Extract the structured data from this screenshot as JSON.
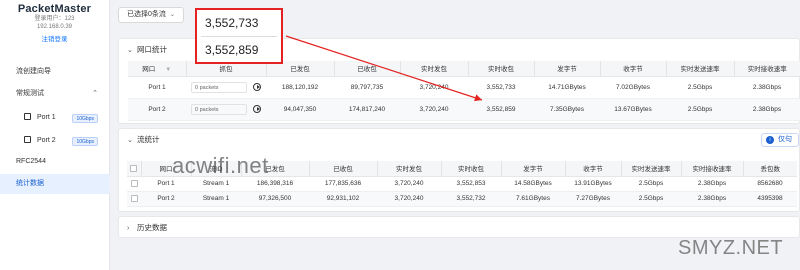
{
  "sidebar": {
    "app_name": "PacketMaster",
    "user_label": "登录用户：123",
    "ip": "192.168.0.39",
    "logout": "注销登录",
    "items": [
      {
        "label": "流创建向导"
      },
      {
        "label": "常规测试"
      },
      {
        "label": "Port 1",
        "badge": "10Gbps"
      },
      {
        "label": "Port 2",
        "badge": "10Gbps"
      },
      {
        "label": "RFC2544"
      },
      {
        "label": "统计数据"
      }
    ]
  },
  "header": {
    "selector_label": "已选择0条流"
  },
  "callout": {
    "values": [
      "3,552,733",
      "3,552,859"
    ]
  },
  "port_stats": {
    "title": "网口统计",
    "columns": [
      "网口",
      "抓包",
      "已发包",
      "已收包",
      "实时发包",
      "实时收包",
      "发字节",
      "收字节",
      "实时发送速率",
      "实时接收速率"
    ],
    "rows": [
      {
        "port": "Port 1",
        "capture": "0 packets",
        "sent": "188,120,192",
        "recv": "89,797,735",
        "rt_sent": "3,720,240",
        "rt_recv": "3,552,733",
        "tx_bytes": "14.71GBytes",
        "rx_bytes": "7.02GBytes",
        "tx_rate": "2.5Gbps",
        "rx_rate": "2.38Gbps"
      },
      {
        "port": "Port 2",
        "capture": "0 packets",
        "sent": "94,047,350",
        "recv": "174,817,240",
        "rt_sent": "3,720,240",
        "rt_recv": "3,552,859",
        "tx_bytes": "7.35GBytes",
        "rx_bytes": "13.67GBytes",
        "tx_rate": "2.5Gbps",
        "rx_rate": "2.38Gbps"
      }
    ]
  },
  "flow_stats": {
    "title": "流统计",
    "only_button": "仅句",
    "columns": [
      "网口",
      "流ID",
      "已发包",
      "已收包",
      "实时发包",
      "实时收包",
      "发字节",
      "收字节",
      "实时发送速率",
      "实时接收速率",
      "丢包数"
    ],
    "rows": [
      {
        "port": "Port 1",
        "flow": "Stream 1",
        "sent": "186,398,316",
        "recv": "177,835,636",
        "rt_sent": "3,720,240",
        "rt_recv": "3,552,853",
        "tx_bytes": "14.58GBytes",
        "rx_bytes": "13.91GBytes",
        "tx_rate": "2.5Gbps",
        "rx_rate": "2.38Gbps",
        "lost": "8562680"
      },
      {
        "port": "Port 2",
        "flow": "Stream 1",
        "sent": "97,326,500",
        "recv": "92,931,102",
        "rt_sent": "3,720,240",
        "rt_recv": "3,552,732",
        "tx_bytes": "7.61GBytes",
        "rx_bytes": "7.27GBytes",
        "tx_rate": "2.5Gbps",
        "rx_rate": "2.38Gbps",
        "lost": "4395398"
      }
    ]
  },
  "history": {
    "title": "历史数据"
  },
  "watermarks": {
    "left": "acwifi.net",
    "right": "SMYZ.NET"
  },
  "colors": {
    "accent": "#1a5fd1",
    "highlight": "#e52222"
  }
}
